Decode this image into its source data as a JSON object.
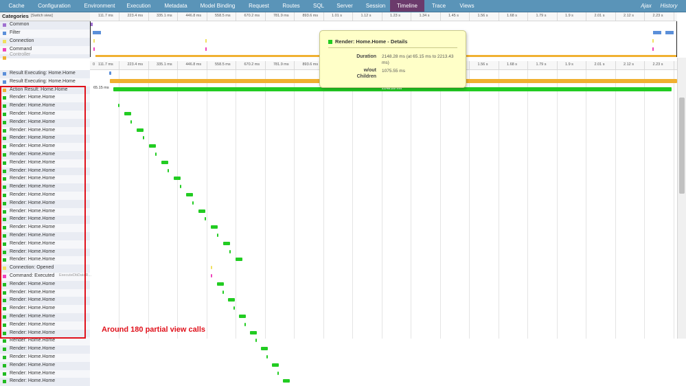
{
  "nav": {
    "tabs": [
      "Cache",
      "Configuration",
      "Environment",
      "Execution",
      "Metadata",
      "Model Binding",
      "Request",
      "Routes",
      "SQL",
      "Server",
      "Session",
      "Timeline",
      "Trace",
      "Views"
    ],
    "active": "Timeline",
    "right": [
      "Ajax",
      "History"
    ]
  },
  "categories": {
    "title": "Categories",
    "switch": "[Switch view]",
    "items": [
      {
        "label": "Common",
        "color": "#a070d0"
      },
      {
        "label": "Filter",
        "color": "#5b8fd9"
      },
      {
        "label": "Connection",
        "color": "#f0e060"
      },
      {
        "label": "Command",
        "color": "#ee44bb"
      },
      {
        "label": "Controller",
        "color": "#f0b030"
      }
    ]
  },
  "ruler_ticks": [
    "111.7 ms",
    "223.4 ms",
    "335.1 ms",
    "446.8 ms",
    "558.5 ms",
    "670.2 ms",
    "781.9 ms",
    "893.6 ms",
    "1.01 s",
    "1.12 s",
    "1.23 s",
    "1.34 s",
    "1.45 s",
    "1.56 s",
    "1.68 s",
    "1.79 s",
    "1.9 s",
    "2.01 s",
    "2.12 s",
    "2.23 s"
  ],
  "ruler2_zero": "0",
  "events": [
    {
      "label": "Result Executing: Home.Home",
      "color": "#5b8fd9"
    },
    {
      "label": "Result Executing: Home.Home",
      "color": "#5b8fd9"
    },
    {
      "label": "Action Result: Home.Home",
      "color": "#f0b030"
    },
    {
      "label": "Render: Home.Home",
      "color": "#22bb22"
    },
    {
      "label": "Render: Home.Home",
      "color": "#22bb22"
    },
    {
      "label": "Render: Home.Home",
      "color": "#22bb22"
    },
    {
      "label": "Render: Home.Home",
      "color": "#22bb22"
    },
    {
      "label": "Render: Home.Home",
      "color": "#22bb22"
    },
    {
      "label": "Render: Home.Home",
      "color": "#22bb22"
    },
    {
      "label": "Render: Home.Home",
      "color": "#22bb22"
    },
    {
      "label": "Render: Home.Home",
      "color": "#22bb22"
    },
    {
      "label": "Render: Home.Home",
      "color": "#22bb22"
    },
    {
      "label": "Render: Home.Home",
      "color": "#22bb22"
    },
    {
      "label": "Render: Home.Home",
      "color": "#22bb22"
    },
    {
      "label": "Render: Home.Home",
      "color": "#22bb22"
    },
    {
      "label": "Render: Home.Home",
      "color": "#22bb22"
    },
    {
      "label": "Render: Home.Home",
      "color": "#22bb22"
    },
    {
      "label": "Render: Home.Home",
      "color": "#22bb22"
    },
    {
      "label": "Render: Home.Home",
      "color": "#22bb22"
    },
    {
      "label": "Render: Home.Home",
      "color": "#22bb22"
    },
    {
      "label": "Render: Home.Home",
      "color": "#22bb22"
    },
    {
      "label": "Render: Home.Home",
      "color": "#22bb22"
    },
    {
      "label": "Render: Home.Home",
      "color": "#22bb22"
    },
    {
      "label": "Render: Home.Home",
      "color": "#22bb22"
    },
    {
      "label": "Connection: Opened",
      "color": "#f0e060"
    },
    {
      "label": "Command: Executed",
      "sub": "ExecuteDbDataR...",
      "color": "#ee44bb"
    },
    {
      "label": "Render: Home.Home",
      "color": "#22bb22"
    },
    {
      "label": "Render: Home.Home",
      "color": "#22bb22"
    },
    {
      "label": "Render: Home.Home",
      "color": "#22bb22"
    },
    {
      "label": "Render: Home.Home",
      "color": "#22bb22"
    },
    {
      "label": "Render: Home.Home",
      "color": "#22bb22"
    },
    {
      "label": "Render: Home.Home",
      "color": "#22bb22"
    },
    {
      "label": "Render: Home.Home",
      "color": "#22bb22"
    },
    {
      "label": "Render: Home.Home",
      "color": "#22bb22"
    },
    {
      "label": "Render: Home.Home",
      "color": "#22bb22"
    },
    {
      "label": "Render: Home.Home",
      "color": "#22bb22"
    },
    {
      "label": "Render: Home.Home",
      "color": "#22bb22"
    },
    {
      "label": "Render: Home.Home",
      "color": "#22bb22"
    },
    {
      "label": "Render: Home.Home",
      "color": "#22bb22"
    }
  ],
  "main_bar": {
    "start_label": "65.15 ms",
    "duration_label": "2148.28 ms"
  },
  "tooltip": {
    "title": "Render: Home.Home - Details",
    "duration_key": "Duration",
    "duration_val": "2148.28 ms (at 65.15 ms to 2213.43 ms)",
    "wo_key_1": "w/out",
    "wo_key_2": "Children",
    "wo_val": "1075.55 ms"
  },
  "annotation": "Around 180 partial view calls"
}
